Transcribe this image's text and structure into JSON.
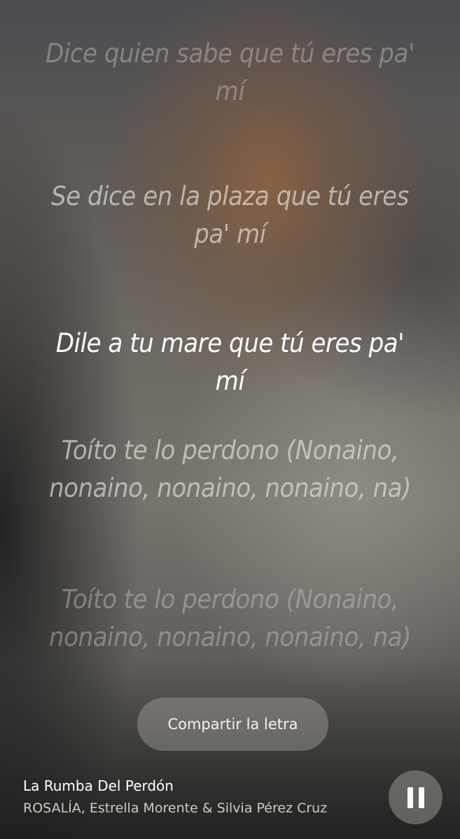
{
  "lyrics": {
    "line1": "Dice quien sabe que tú eres pa' mí",
    "line2": "Se dice en la plaza que tú eres pa' mí",
    "line3": "Dile a tu mare que tú eres pa' mí",
    "line4": "Toíto te lo perdono (Nonaino, nonaino, nonaino, nonaino, na)",
    "line5": "Toíto te lo perdono (Nonaino, nonaino, nonaino, nonaino, na)"
  },
  "actions": {
    "share_label": "Compartir la letra"
  },
  "now_playing": {
    "title": "La Rumba Del Perdón",
    "artist": "ROSALÍA, Estrella Morente & Silvia Pérez Cruz",
    "state": "playing",
    "control_icon": "pause-icon"
  }
}
